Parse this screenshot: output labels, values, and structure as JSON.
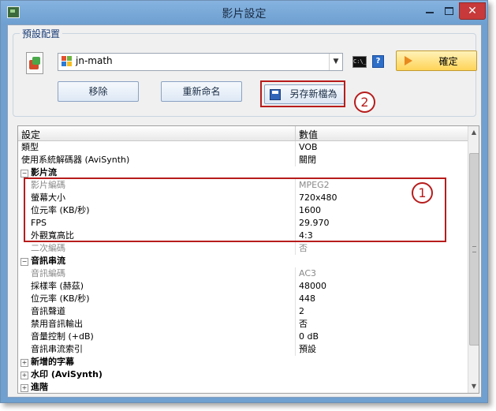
{
  "window": {
    "title": "影片設定"
  },
  "preset": {
    "group_label": "預設配置",
    "combo_value": "jn-math",
    "cmd_icon_text": "C:\\_",
    "help_icon_text": "?",
    "ok_label": "確定",
    "remove_label": "移除",
    "rename_label": "重新命名",
    "saveas_label": "另存新檔為"
  },
  "grid": {
    "header": {
      "col1": "設定",
      "col2": "數值"
    },
    "rows": [
      {
        "label": "類型",
        "value": "VOB"
      },
      {
        "label": "使用系統解碼器 (AviSynth)",
        "value": "關閉"
      },
      {
        "label": "影片流",
        "toggle": "−"
      },
      {
        "label": "影片編碼",
        "value": "MPEG2"
      },
      {
        "label": "螢幕大小",
        "value": "720x480"
      },
      {
        "label": "位元率 (KB/秒)",
        "value": "1600"
      },
      {
        "label": "FPS",
        "value": "29.970"
      },
      {
        "label": "外觀寬高比",
        "value": "4:3"
      },
      {
        "label": "二次編碼",
        "value": "否"
      },
      {
        "label": "音訊串流",
        "toggle": "−"
      },
      {
        "label": "音訊編碼",
        "value": "AC3"
      },
      {
        "label": "採樣率 (赫茲)",
        "value": "48000"
      },
      {
        "label": "位元率 (KB/秒)",
        "value": "448"
      },
      {
        "label": "音訊聲道",
        "value": "2"
      },
      {
        "label": "禁用音訊輸出",
        "value": "否"
      },
      {
        "label": "音量控制 (+dB)",
        "value": "0 dB"
      },
      {
        "label": "音訊串流索引",
        "value": "預設"
      },
      {
        "label": "新增的字幕",
        "toggle": "+"
      },
      {
        "label": "水印 (AviSynth)",
        "toggle": "+"
      },
      {
        "label": "進階",
        "toggle": "+"
      }
    ]
  },
  "annotations": {
    "badge1": "1",
    "badge2": "2"
  },
  "colors": {
    "accent": "#b71c1c",
    "titlebar": "#6fa0cf",
    "ok_button": "#ffd457"
  }
}
